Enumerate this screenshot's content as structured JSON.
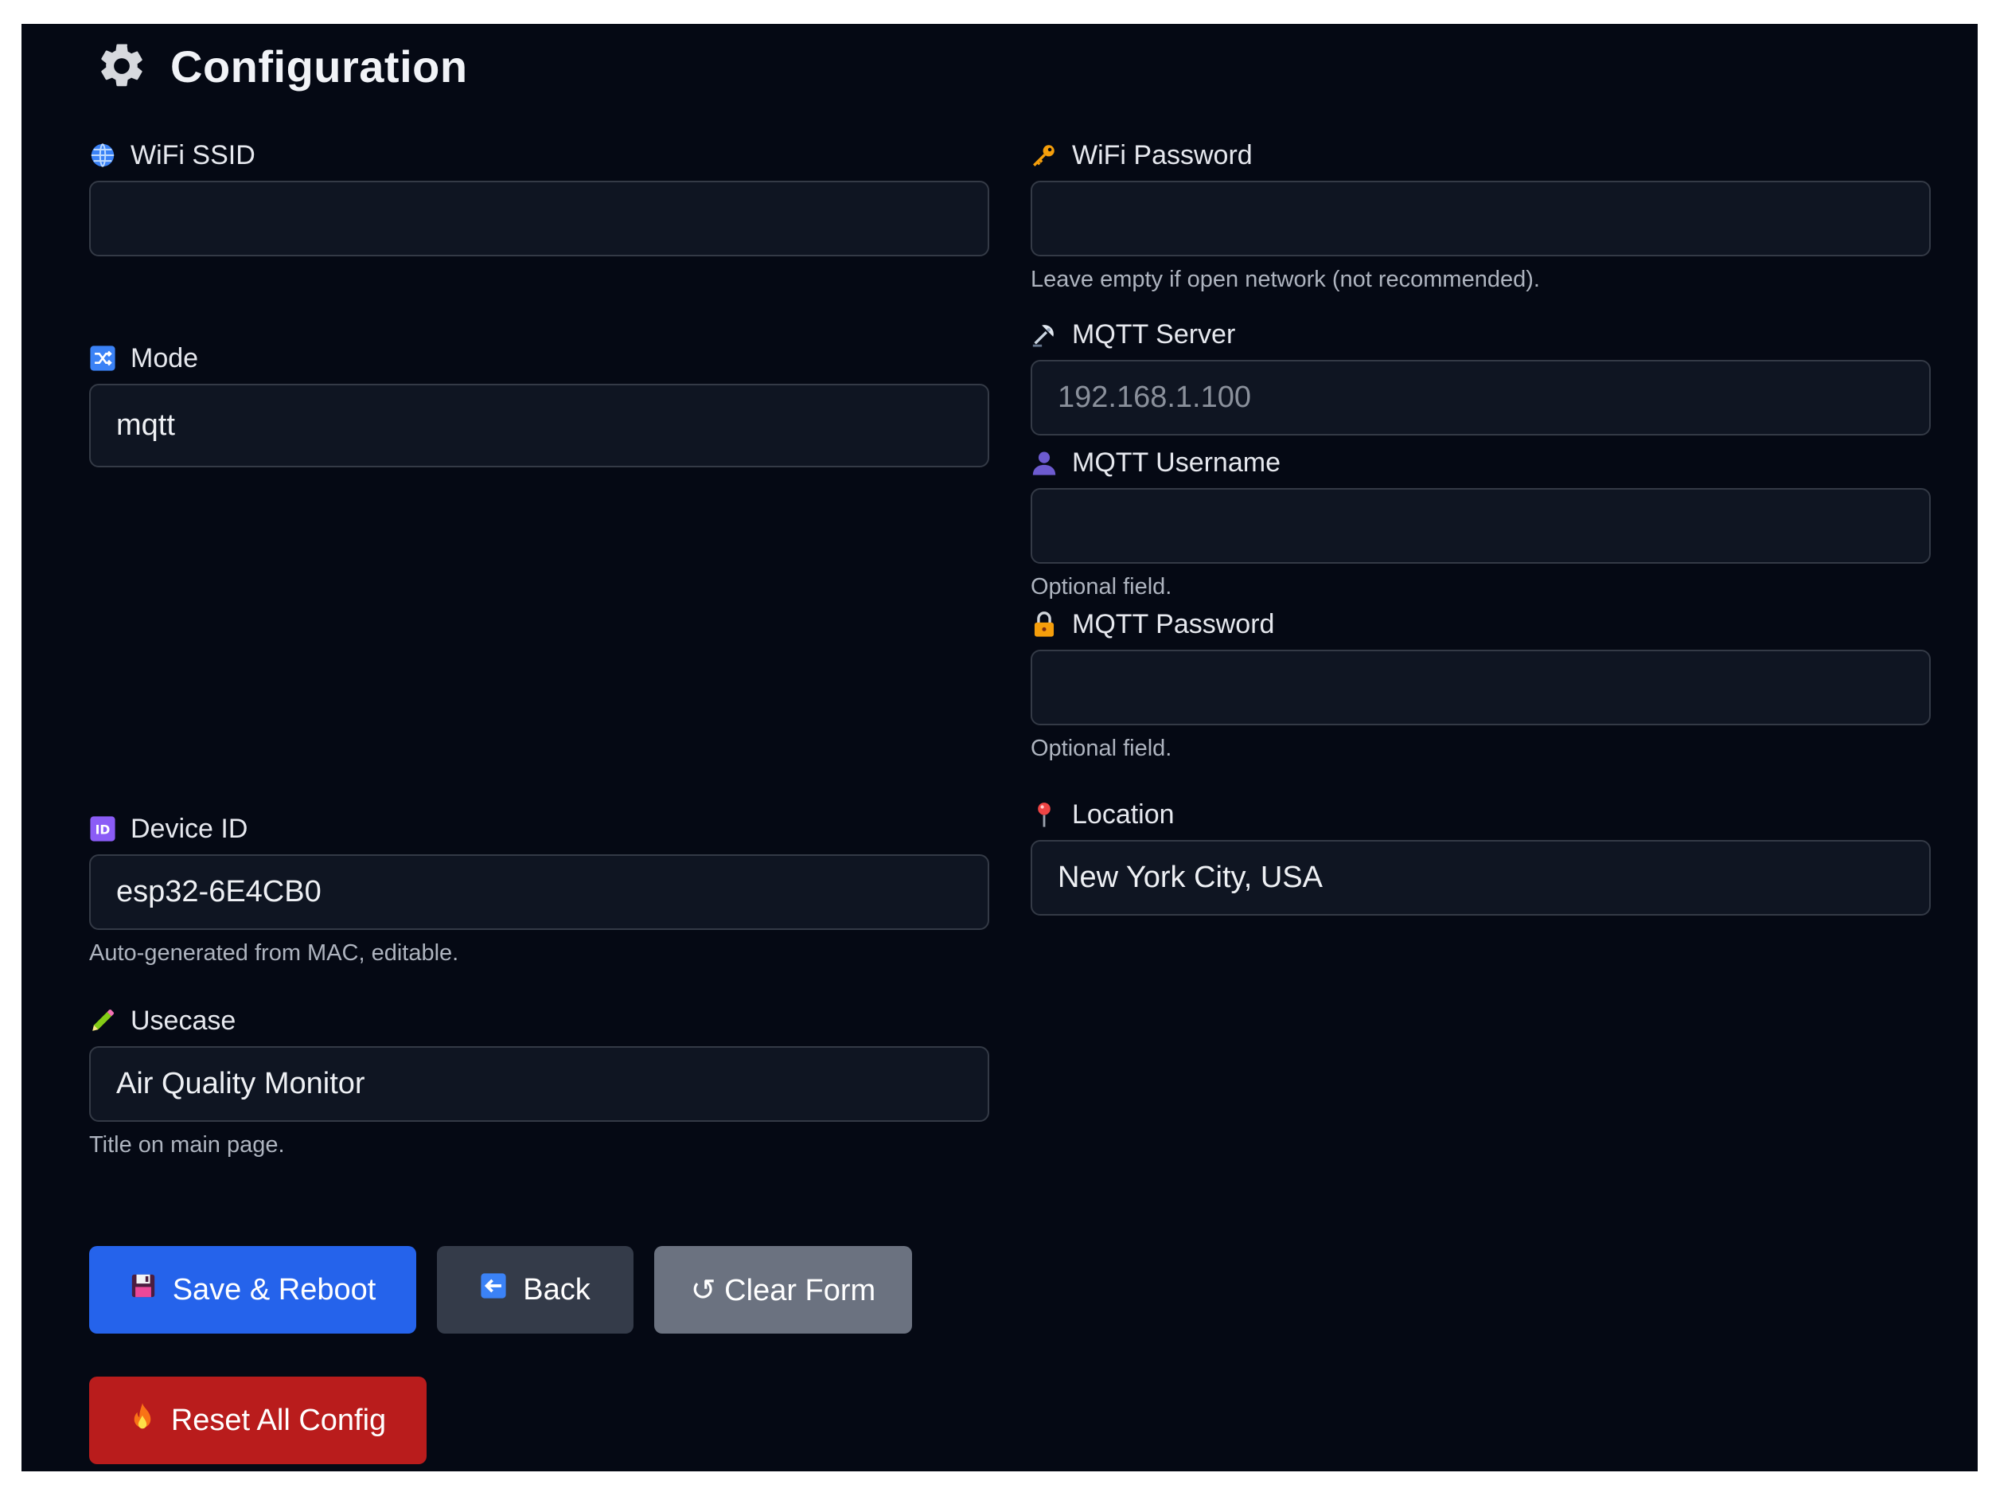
{
  "header": {
    "title": "Configuration",
    "icon": "gear-icon"
  },
  "fields": {
    "wifi_ssid": {
      "label": "WiFi SSID",
      "icon": "globe-icon",
      "value": "",
      "placeholder": ""
    },
    "wifi_password": {
      "label": "WiFi Password",
      "icon": "key-icon",
      "value": "",
      "placeholder": "",
      "help": "Leave empty if open network (not recommended)."
    },
    "mode": {
      "label": "Mode",
      "icon": "shuffle-icon",
      "value": "mqtt"
    },
    "mqtt_server": {
      "label": "MQTT Server",
      "icon": "satellite-icon",
      "value": "",
      "placeholder": "192.168.1.100"
    },
    "mqtt_username": {
      "label": "MQTT Username",
      "icon": "user-icon",
      "value": "",
      "placeholder": "",
      "help": "Optional field."
    },
    "mqtt_password": {
      "label": "MQTT Password",
      "icon": "lock-icon",
      "value": "",
      "placeholder": "",
      "help": "Optional field."
    },
    "device_id": {
      "label": "Device ID",
      "icon": "id-icon",
      "value": "esp32-6E4CB0",
      "help": "Auto-generated from MAC, editable."
    },
    "location": {
      "label": "Location",
      "icon": "pin-icon",
      "value": "New York City, USA"
    },
    "usecase": {
      "label": "Usecase",
      "icon": "pencil-icon",
      "value": "Air Quality Monitor",
      "help": "Title on main page."
    }
  },
  "buttons": {
    "save": {
      "label": "Save & Reboot",
      "icon": "floppy-disk-icon"
    },
    "back": {
      "label": "Back",
      "icon": "arrow-left-icon"
    },
    "clear": {
      "label": "↺ Clear Form"
    },
    "reset": {
      "label": "Reset All Config",
      "icon": "fire-icon"
    }
  },
  "colors": {
    "background": "#050914",
    "input_bg": "#0f1522",
    "save": "#2563eb",
    "back": "#343b49",
    "clear": "#6b7280",
    "reset": "#b91c1c"
  }
}
